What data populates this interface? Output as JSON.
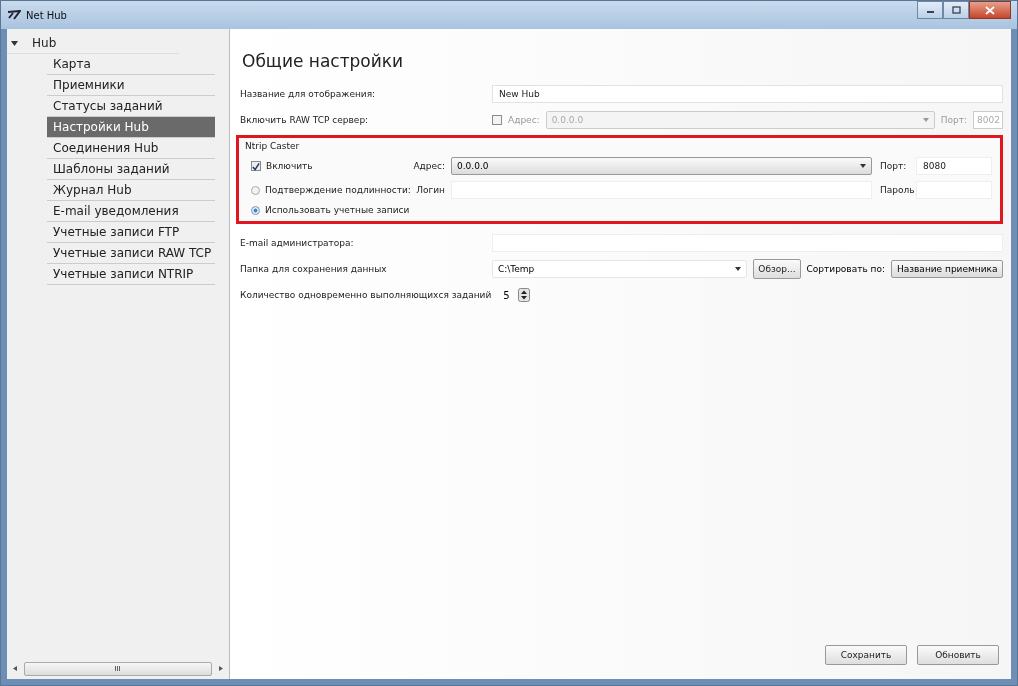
{
  "window": {
    "title": "Net Hub"
  },
  "sidebar": {
    "items": [
      {
        "label": "Hub",
        "expanded": true,
        "children": [
          {
            "label": "Карта",
            "selected": false
          },
          {
            "label": "Приемники",
            "selected": false
          },
          {
            "label": "Статусы заданий",
            "selected": false
          },
          {
            "label": "Настройки Hub",
            "selected": true
          },
          {
            "label": "Соединения Hub",
            "selected": false
          },
          {
            "label": "Шаблоны заданий",
            "selected": false
          },
          {
            "label": "Журнал Hub",
            "selected": false
          },
          {
            "label": "E-mail уведомления",
            "selected": false
          },
          {
            "label": "Учетные записи FTP",
            "selected": false
          },
          {
            "label": "Учетные записи RAW TCP",
            "selected": false
          },
          {
            "label": "Учетные записи NTRIP",
            "selected": false
          }
        ]
      }
    ]
  },
  "page": {
    "heading": "Общие настройки",
    "display_name": {
      "label": "Название для отображения:",
      "value": "New Hub"
    },
    "raw_tcp": {
      "label": "Включить RAW TCP сервер:",
      "checked": false,
      "address_label": "Адрес:",
      "address": "0.0.0.0",
      "port_label": "Порт:",
      "port": "8002"
    },
    "ntrip": {
      "title": "Ntrip Caster",
      "enable": {
        "label": "Включить",
        "checked": true
      },
      "address_label": "Адрес:",
      "address": "0.0.0.0",
      "port_label": "Порт:",
      "port": "8080",
      "login_label": "Логин",
      "password_label": "Пароль",
      "auth_options": [
        {
          "label": "Подтверждение подлинности:",
          "selected": false
        },
        {
          "label": "Использовать учетные записи",
          "selected": true
        }
      ]
    },
    "admin_email": {
      "label": "E-mail администратора:"
    },
    "data_folder": {
      "label": "Папка для сохранения данных",
      "value": "C:\\Temp",
      "browse": "Обзор...",
      "sort_label": "Сортировать по:",
      "sort_value": "Название приемника"
    },
    "concurrent_jobs": {
      "label": "Количество одновременно выполняющихся заданий",
      "value": "5"
    },
    "buttons": [
      "Сохранить",
      "Обновить"
    ]
  }
}
